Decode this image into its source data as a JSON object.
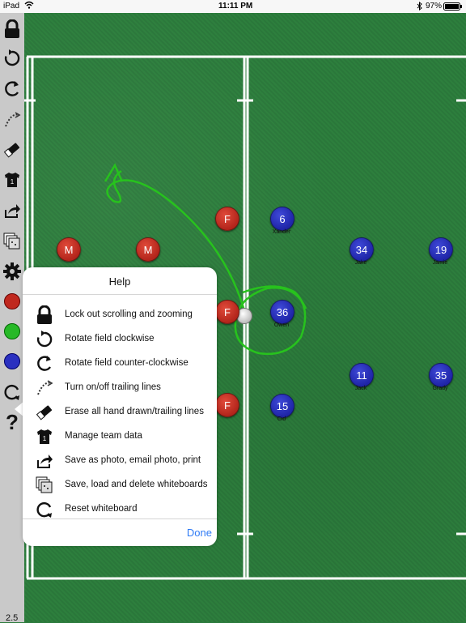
{
  "status": {
    "device": "iPad",
    "time": "11:11 PM",
    "battery": "97%"
  },
  "sidebar": {
    "tools": [
      "lock-icon",
      "rotate-cw-icon",
      "rotate-ccw-icon",
      "trailing-lines-icon",
      "eraser-icon",
      "jersey-icon",
      "share-icon",
      "whiteboards-icon",
      "gear-icon",
      "red-player-icon",
      "green-player-icon",
      "blue-player-icon",
      "reset-icon",
      "help-icon"
    ],
    "version": "2.5"
  },
  "players": {
    "red": [
      {
        "label": "M"
      },
      {
        "label": "M"
      },
      {
        "label": "F"
      },
      {
        "label": "F"
      },
      {
        "label": "F"
      }
    ],
    "blue": [
      {
        "label": "6",
        "name": "Xander"
      },
      {
        "label": "36",
        "name": "Owen"
      },
      {
        "label": "15",
        "name": "Cid"
      },
      {
        "label": "34",
        "name": "Jake"
      },
      {
        "label": "19",
        "name": "Jamie"
      },
      {
        "label": "11",
        "name": "Jack"
      },
      {
        "label": "35",
        "name": "Grady"
      }
    ]
  },
  "help": {
    "title": "Help",
    "items": [
      {
        "icon": "lock-icon",
        "label": "Lock out scrolling and zooming"
      },
      {
        "icon": "rotate-cw-icon",
        "label": "Rotate field clockwise"
      },
      {
        "icon": "rotate-ccw-icon",
        "label": "Rotate field counter-clockwise"
      },
      {
        "icon": "trailing-lines-icon",
        "label": "Turn on/off trailing lines"
      },
      {
        "icon": "eraser-icon",
        "label": "Erase all hand drawn/trailing lines"
      },
      {
        "icon": "jersey-icon",
        "label": "Manage team data"
      },
      {
        "icon": "share-icon",
        "label": "Save as photo, email photo, print"
      },
      {
        "icon": "whiteboards-icon",
        "label": "Save, load and delete whiteboards"
      },
      {
        "icon": "reset-icon",
        "label": "Reset whiteboard"
      }
    ],
    "done_label": "Done"
  },
  "colors": {
    "field": "#2a7a3c",
    "red_player": "#c0281e",
    "blue_player": "#2a30c0",
    "drawing": "#27c21d",
    "link": "#2f7bf5"
  }
}
